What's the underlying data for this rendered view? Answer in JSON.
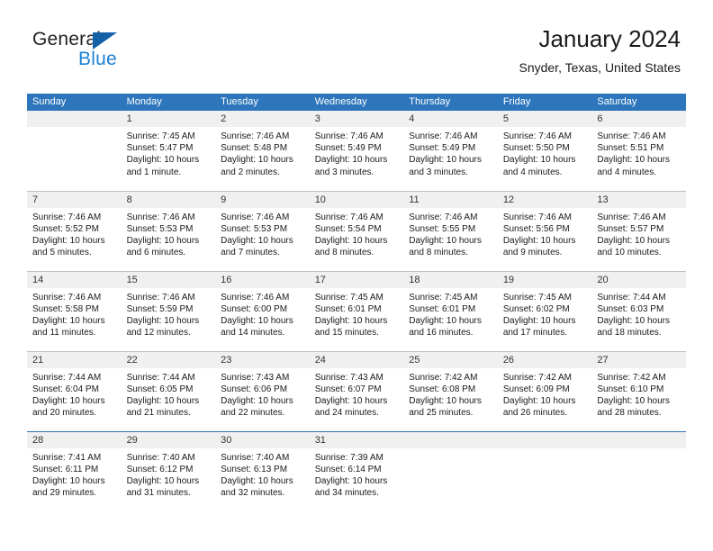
{
  "brand": {
    "name_part1": "General",
    "name_part2": "Blue",
    "triangle_color": "#1461a8",
    "blue_text_color": "#1d82d4"
  },
  "header": {
    "title": "January 2024",
    "subtitle": "Snyder, Texas, United States"
  },
  "theme": {
    "header_row_bg": "#2e76bc",
    "daynum_band_bg": "#f0f0f0",
    "row_divider": "#bfbfbf",
    "page_bg": "#ffffff"
  },
  "calendar": {
    "weekday_headers": [
      "Sunday",
      "Monday",
      "Tuesday",
      "Wednesday",
      "Thursday",
      "Friday",
      "Saturday"
    ],
    "weeks": [
      [
        {
          "day": "",
          "sunrise": "",
          "sunset": "",
          "daylight_line1": "",
          "daylight_line2": ""
        },
        {
          "day": "1",
          "sunrise": "Sunrise: 7:45 AM",
          "sunset": "Sunset: 5:47 PM",
          "daylight_line1": "Daylight: 10 hours",
          "daylight_line2": "and 1 minute."
        },
        {
          "day": "2",
          "sunrise": "Sunrise: 7:46 AM",
          "sunset": "Sunset: 5:48 PM",
          "daylight_line1": "Daylight: 10 hours",
          "daylight_line2": "and 2 minutes."
        },
        {
          "day": "3",
          "sunrise": "Sunrise: 7:46 AM",
          "sunset": "Sunset: 5:49 PM",
          "daylight_line1": "Daylight: 10 hours",
          "daylight_line2": "and 3 minutes."
        },
        {
          "day": "4",
          "sunrise": "Sunrise: 7:46 AM",
          "sunset": "Sunset: 5:49 PM",
          "daylight_line1": "Daylight: 10 hours",
          "daylight_line2": "and 3 minutes."
        },
        {
          "day": "5",
          "sunrise": "Sunrise: 7:46 AM",
          "sunset": "Sunset: 5:50 PM",
          "daylight_line1": "Daylight: 10 hours",
          "daylight_line2": "and 4 minutes."
        },
        {
          "day": "6",
          "sunrise": "Sunrise: 7:46 AM",
          "sunset": "Sunset: 5:51 PM",
          "daylight_line1": "Daylight: 10 hours",
          "daylight_line2": "and 4 minutes."
        }
      ],
      [
        {
          "day": "7",
          "sunrise": "Sunrise: 7:46 AM",
          "sunset": "Sunset: 5:52 PM",
          "daylight_line1": "Daylight: 10 hours",
          "daylight_line2": "and 5 minutes."
        },
        {
          "day": "8",
          "sunrise": "Sunrise: 7:46 AM",
          "sunset": "Sunset: 5:53 PM",
          "daylight_line1": "Daylight: 10 hours",
          "daylight_line2": "and 6 minutes."
        },
        {
          "day": "9",
          "sunrise": "Sunrise: 7:46 AM",
          "sunset": "Sunset: 5:53 PM",
          "daylight_line1": "Daylight: 10 hours",
          "daylight_line2": "and 7 minutes."
        },
        {
          "day": "10",
          "sunrise": "Sunrise: 7:46 AM",
          "sunset": "Sunset: 5:54 PM",
          "daylight_line1": "Daylight: 10 hours",
          "daylight_line2": "and 8 minutes."
        },
        {
          "day": "11",
          "sunrise": "Sunrise: 7:46 AM",
          "sunset": "Sunset: 5:55 PM",
          "daylight_line1": "Daylight: 10 hours",
          "daylight_line2": "and 8 minutes."
        },
        {
          "day": "12",
          "sunrise": "Sunrise: 7:46 AM",
          "sunset": "Sunset: 5:56 PM",
          "daylight_line1": "Daylight: 10 hours",
          "daylight_line2": "and 9 minutes."
        },
        {
          "day": "13",
          "sunrise": "Sunrise: 7:46 AM",
          "sunset": "Sunset: 5:57 PM",
          "daylight_line1": "Daylight: 10 hours",
          "daylight_line2": "and 10 minutes."
        }
      ],
      [
        {
          "day": "14",
          "sunrise": "Sunrise: 7:46 AM",
          "sunset": "Sunset: 5:58 PM",
          "daylight_line1": "Daylight: 10 hours",
          "daylight_line2": "and 11 minutes."
        },
        {
          "day": "15",
          "sunrise": "Sunrise: 7:46 AM",
          "sunset": "Sunset: 5:59 PM",
          "daylight_line1": "Daylight: 10 hours",
          "daylight_line2": "and 12 minutes."
        },
        {
          "day": "16",
          "sunrise": "Sunrise: 7:46 AM",
          "sunset": "Sunset: 6:00 PM",
          "daylight_line1": "Daylight: 10 hours",
          "daylight_line2": "and 14 minutes."
        },
        {
          "day": "17",
          "sunrise": "Sunrise: 7:45 AM",
          "sunset": "Sunset: 6:01 PM",
          "daylight_line1": "Daylight: 10 hours",
          "daylight_line2": "and 15 minutes."
        },
        {
          "day": "18",
          "sunrise": "Sunrise: 7:45 AM",
          "sunset": "Sunset: 6:01 PM",
          "daylight_line1": "Daylight: 10 hours",
          "daylight_line2": "and 16 minutes."
        },
        {
          "day": "19",
          "sunrise": "Sunrise: 7:45 AM",
          "sunset": "Sunset: 6:02 PM",
          "daylight_line1": "Daylight: 10 hours",
          "daylight_line2": "and 17 minutes."
        },
        {
          "day": "20",
          "sunrise": "Sunrise: 7:44 AM",
          "sunset": "Sunset: 6:03 PM",
          "daylight_line1": "Daylight: 10 hours",
          "daylight_line2": "and 18 minutes."
        }
      ],
      [
        {
          "day": "21",
          "sunrise": "Sunrise: 7:44 AM",
          "sunset": "Sunset: 6:04 PM",
          "daylight_line1": "Daylight: 10 hours",
          "daylight_line2": "and 20 minutes."
        },
        {
          "day": "22",
          "sunrise": "Sunrise: 7:44 AM",
          "sunset": "Sunset: 6:05 PM",
          "daylight_line1": "Daylight: 10 hours",
          "daylight_line2": "and 21 minutes."
        },
        {
          "day": "23",
          "sunrise": "Sunrise: 7:43 AM",
          "sunset": "Sunset: 6:06 PM",
          "daylight_line1": "Daylight: 10 hours",
          "daylight_line2": "and 22 minutes."
        },
        {
          "day": "24",
          "sunrise": "Sunrise: 7:43 AM",
          "sunset": "Sunset: 6:07 PM",
          "daylight_line1": "Daylight: 10 hours",
          "daylight_line2": "and 24 minutes."
        },
        {
          "day": "25",
          "sunrise": "Sunrise: 7:42 AM",
          "sunset": "Sunset: 6:08 PM",
          "daylight_line1": "Daylight: 10 hours",
          "daylight_line2": "and 25 minutes."
        },
        {
          "day": "26",
          "sunrise": "Sunrise: 7:42 AM",
          "sunset": "Sunset: 6:09 PM",
          "daylight_line1": "Daylight: 10 hours",
          "daylight_line2": "and 26 minutes."
        },
        {
          "day": "27",
          "sunrise": "Sunrise: 7:42 AM",
          "sunset": "Sunset: 6:10 PM",
          "daylight_line1": "Daylight: 10 hours",
          "daylight_line2": "and 28 minutes."
        }
      ],
      [
        {
          "day": "28",
          "sunrise": "Sunrise: 7:41 AM",
          "sunset": "Sunset: 6:11 PM",
          "daylight_line1": "Daylight: 10 hours",
          "daylight_line2": "and 29 minutes."
        },
        {
          "day": "29",
          "sunrise": "Sunrise: 7:40 AM",
          "sunset": "Sunset: 6:12 PM",
          "daylight_line1": "Daylight: 10 hours",
          "daylight_line2": "and 31 minutes."
        },
        {
          "day": "30",
          "sunrise": "Sunrise: 7:40 AM",
          "sunset": "Sunset: 6:13 PM",
          "daylight_line1": "Daylight: 10 hours",
          "daylight_line2": "and 32 minutes."
        },
        {
          "day": "31",
          "sunrise": "Sunrise: 7:39 AM",
          "sunset": "Sunset: 6:14 PM",
          "daylight_line1": "Daylight: 10 hours",
          "daylight_line2": "and 34 minutes."
        },
        {
          "day": "",
          "sunrise": "",
          "sunset": "",
          "daylight_line1": "",
          "daylight_line2": ""
        },
        {
          "day": "",
          "sunrise": "",
          "sunset": "",
          "daylight_line1": "",
          "daylight_line2": ""
        },
        {
          "day": "",
          "sunrise": "",
          "sunset": "",
          "daylight_line1": "",
          "daylight_line2": ""
        }
      ]
    ]
  }
}
